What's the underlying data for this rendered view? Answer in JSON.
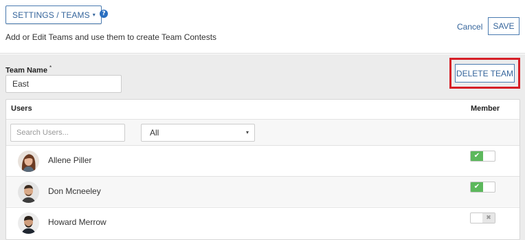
{
  "header": {
    "breadcrumb": "SETTINGS / TEAMS",
    "breadcrumb_caret": "▾",
    "help_icon": "?",
    "subtitle": "Add or Edit Teams and use them to create Team Contests",
    "cancel_label": "Cancel",
    "save_label": "SAVE"
  },
  "team": {
    "name_label": "Team Name",
    "required_mark": "*",
    "name_value": "East",
    "delete_label": "DELETE TEAM"
  },
  "table": {
    "users_header": "Users",
    "member_header": "Member",
    "search_placeholder": "Search Users...",
    "filter_value": "All",
    "filter_arrow": "▾",
    "users": [
      {
        "name": "Allene Piller",
        "member": true,
        "avatar": "female-avatar"
      },
      {
        "name": "Don Mcneeley",
        "member": true,
        "avatar": "male-avatar"
      },
      {
        "name": "Howard Merrow",
        "member": false,
        "avatar": "male-avatar"
      }
    ]
  },
  "toggle_glyphs": {
    "on": "✔",
    "off": "✖"
  },
  "colors": {
    "accent": "#34649b",
    "highlight_border": "#d61f27",
    "toggle_on": "#5cb85c",
    "help_icon": "#2a6fc0"
  }
}
